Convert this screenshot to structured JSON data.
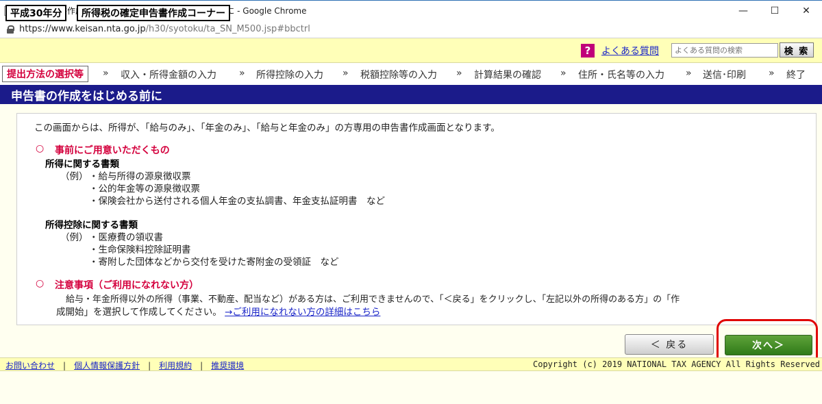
{
  "browser": {
    "window_title": "【確定申告書作成コーナー】-申告書の作成をはじめる前に - Google Chrome",
    "url_host": "https://www.keisan.nta.go.jp",
    "url_path": "/h30/syotoku/ta_SN_M500.jsp#bbctrl",
    "minimize": "—",
    "maximize": "☐",
    "close": "✕"
  },
  "header": {
    "year_badge": "平成30年分",
    "corner_title": "所得税の確定申告書作成コーナー",
    "faq_icon": "?",
    "faq_link": "よくある質問",
    "faq_search_placeholder": "よくある質問の検索",
    "search_button": "検 索"
  },
  "steps": {
    "current": "提出方法の選択等",
    "s1": "収入・所得金額の入力",
    "s2": "所得控除の入力",
    "s3": "税額控除等の入力",
    "s4": "計算結果の確認",
    "s5": "住所・氏名等の入力",
    "s6": "送信･印刷",
    "s7": "終了",
    "separator": "»"
  },
  "page": {
    "title": "申告書の作成をはじめる前に",
    "intro": "この画面からは、所得が、「給与のみ」、「年金のみ」、「給与と年金のみ」の方専用の申告書作成画面となります。",
    "circle": "○",
    "prep_heading": "事前にご用意いただくもの",
    "income_docs_heading": "所得に関する書類",
    "example_label": "（例）",
    "income_docs": [
      "・給与所得の源泉徴収票",
      "・公的年金等の源泉徴収票",
      "・保険会社から送付される個人年金の支払調書、年金支払証明書　など"
    ],
    "deduction_docs_heading": "所得控除に関する書類",
    "deduction_docs": [
      "・医療費の領収書",
      "・生命保険料控除証明書",
      "・寄附した団体などから交付を受けた寄附金の受領証　など"
    ],
    "notice_heading": "注意事項（ご利用になれない方）",
    "notice_line1": "給与・年金所得以外の所得（事業、不動産、配当など）がある方は、ご利用できませんので、「＜戻る」をクリックし、「左記以外の所得のある方」の「作",
    "notice_line2": "成開始」を選択して作成してください。",
    "notice_link": "→ご利用になれない方の詳細はこちら"
  },
  "buttons": {
    "back": "＜ 戻る",
    "next": "次へ＞"
  },
  "footer": {
    "contact": "お問い合わせ",
    "privacy": "個人情報保護方針",
    "terms": "利用規約",
    "environment": "推奨環境",
    "separator": "|",
    "copyright": "Copyright (c) 2019 NATIONAL TAX AGENCY All Rights Reserved"
  }
}
